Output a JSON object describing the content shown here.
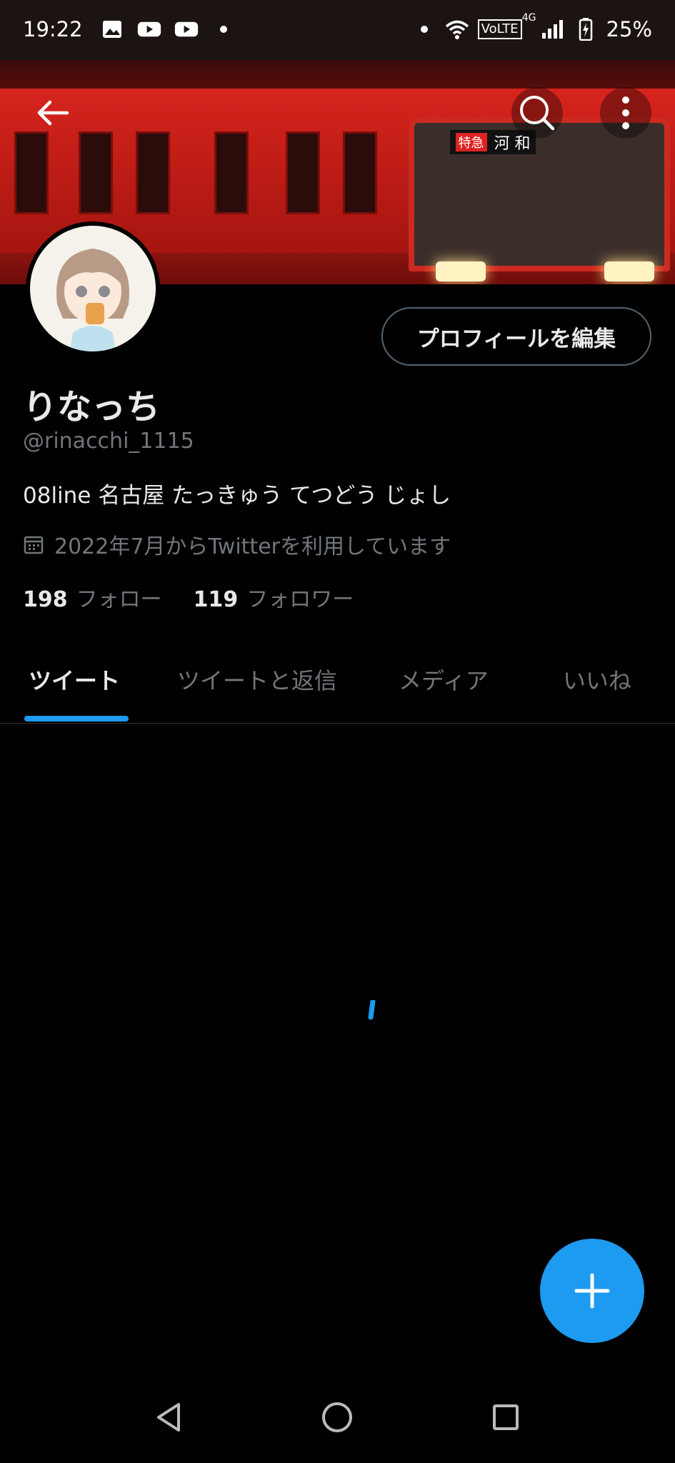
{
  "status_bar": {
    "time": "19:22",
    "network_label": "VoLTE",
    "network_gen": "4G",
    "battery": "25%",
    "left_icons": [
      "image-icon",
      "youtube-icon",
      "youtube-icon",
      "dot-icon"
    ],
    "right_icons": [
      "dot-icon",
      "wifi-icon",
      "volte-icon",
      "signal-icon",
      "battery-charging-icon"
    ]
  },
  "header": {
    "destination_tag": "特急",
    "destination": "河 和"
  },
  "profile": {
    "edit_button": "プロフィールを編集",
    "display_name": "りなっち",
    "handle": "@rinacchi_1115",
    "bio": "08line 名古屋 たっきゅう てつどう じょし",
    "joined": "2022年7月からTwitterを利用しています",
    "following_count": "198",
    "following_label": "フォロー",
    "followers_count": "119",
    "followers_label": "フォロワー"
  },
  "tabs": [
    {
      "label": "ツイート",
      "active": true
    },
    {
      "label": "ツイートと返信",
      "active": false
    },
    {
      "label": "メディア",
      "active": false
    },
    {
      "label": "いいね",
      "active": false
    }
  ],
  "colors": {
    "accent": "#1d9bf0",
    "background": "#000000",
    "secondary_text": "#71767b"
  }
}
